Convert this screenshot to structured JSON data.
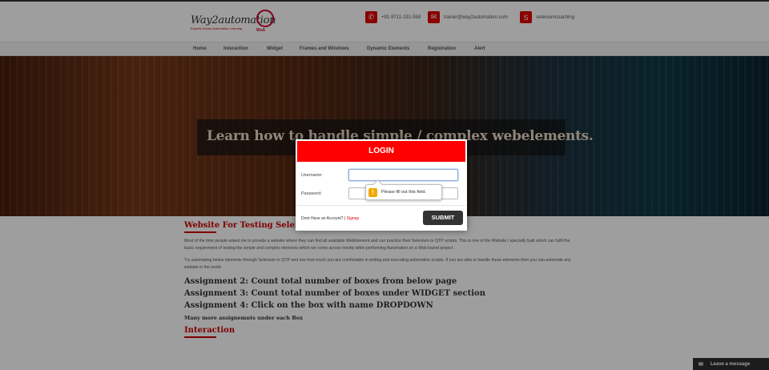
{
  "header": {
    "logo": {
      "name": "Way2automation",
      "tagline": "Experts Driven Automation Learning",
      "mark": "WsA"
    },
    "contacts": [
      {
        "icon": "phone-icon",
        "glyph": "✆",
        "text": "+91-9711-191-558"
      },
      {
        "icon": "email-icon",
        "glyph": "✉",
        "text": "trainer@way2automation.com"
      },
      {
        "icon": "skype-icon",
        "glyph": "S",
        "text": "seleniumcoaching"
      }
    ]
  },
  "nav": {
    "items": [
      {
        "label": "Home"
      },
      {
        "label": "Interaction"
      },
      {
        "label": "Widget"
      },
      {
        "label": "Frames and Windows"
      },
      {
        "label": "Dynamic Elements"
      },
      {
        "label": "Registration"
      },
      {
        "label": "Alert"
      }
    ]
  },
  "hero": {
    "text": "Learn how to handle simple / complex webelements."
  },
  "content": {
    "section_title": "Website For Testing Selenium / QTP Scripts",
    "para1": "Most of the time people asked me to provide a website where they can find all available WebElement and can practice their Selenium or QTP scripts. This is one of the Website I specially built which can fulfil the basic requirement of testing the simple and complex elements which we come across mostly while performing Automation on a Web based project .",
    "para2": "Try automating below elements through Selenium or QTP and see how much you are comfortable in writing and executing automation scripts. If you are able to handle these elements then you can automate any website in the world.",
    "assignments": [
      "Assignment 2: Count total number of boxes from below page",
      "Assignment 3: Count total number of boxes under WIDGET section",
      "Assignment 4: Click on the box with name DROPDOWN"
    ],
    "many_more": "Many more assignemnts under each Box",
    "next_section": "Interaction"
  },
  "modal": {
    "title": "LOGIN",
    "username_label": "Username:",
    "username_value": "",
    "password_label": "Password:",
    "password_value": "",
    "footer_text": "Dont Have an Account?",
    "separator": " | ",
    "signup_label": "Signup",
    "submit_label": "SUBMIT"
  },
  "validation": {
    "icon": "warning-icon",
    "glyph": "!",
    "message": "Please fill out this field."
  },
  "chat": {
    "icon": "envelope-icon",
    "glyph": "✉",
    "label": "Leave a message"
  },
  "colors": {
    "accent": "#ff0000",
    "dark_button": "#333333",
    "warning": "#f0a800"
  }
}
